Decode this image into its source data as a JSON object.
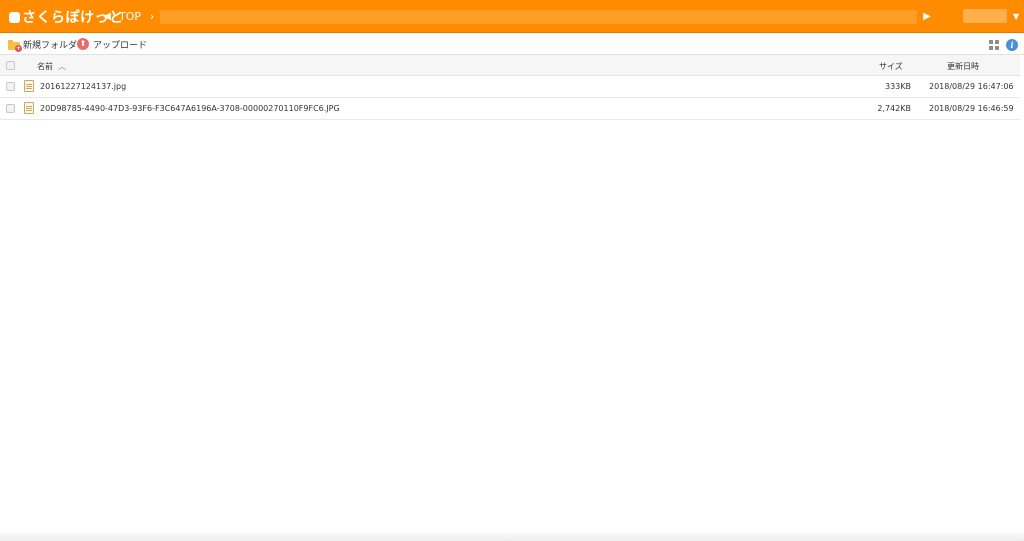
{
  "app": {
    "logo_text": "さくらぽけっと",
    "accent_color": "#ff8c00"
  },
  "header": {
    "breadcrumb": [
      "TOP"
    ],
    "back_icon": "triangle-left-icon",
    "forward_icon": "triangle-right-icon",
    "user_name": "",
    "user_menu_icon": "caret-down-icon"
  },
  "toolbar": {
    "new_folder_label": "新規フォルダ",
    "upload_label": "アップロード",
    "grid_view_icon": "grid-icon",
    "info_icon": "info-icon"
  },
  "table": {
    "columns": {
      "name": "名前",
      "size": "サイズ",
      "modified": "更新日時"
    },
    "sort": {
      "column": "name",
      "direction": "ascending"
    },
    "rows": [
      {
        "name": "20161227124137.jpg",
        "size": "333KB",
        "modified": "2018/08/29 16:47:06"
      },
      {
        "name": "20D98785-4490-47D3-93F6-F3C647A6196A-3708-00000270110F9FC6.JPG",
        "size": "2,742KB",
        "modified": "2018/08/29 16:46:59"
      }
    ]
  }
}
